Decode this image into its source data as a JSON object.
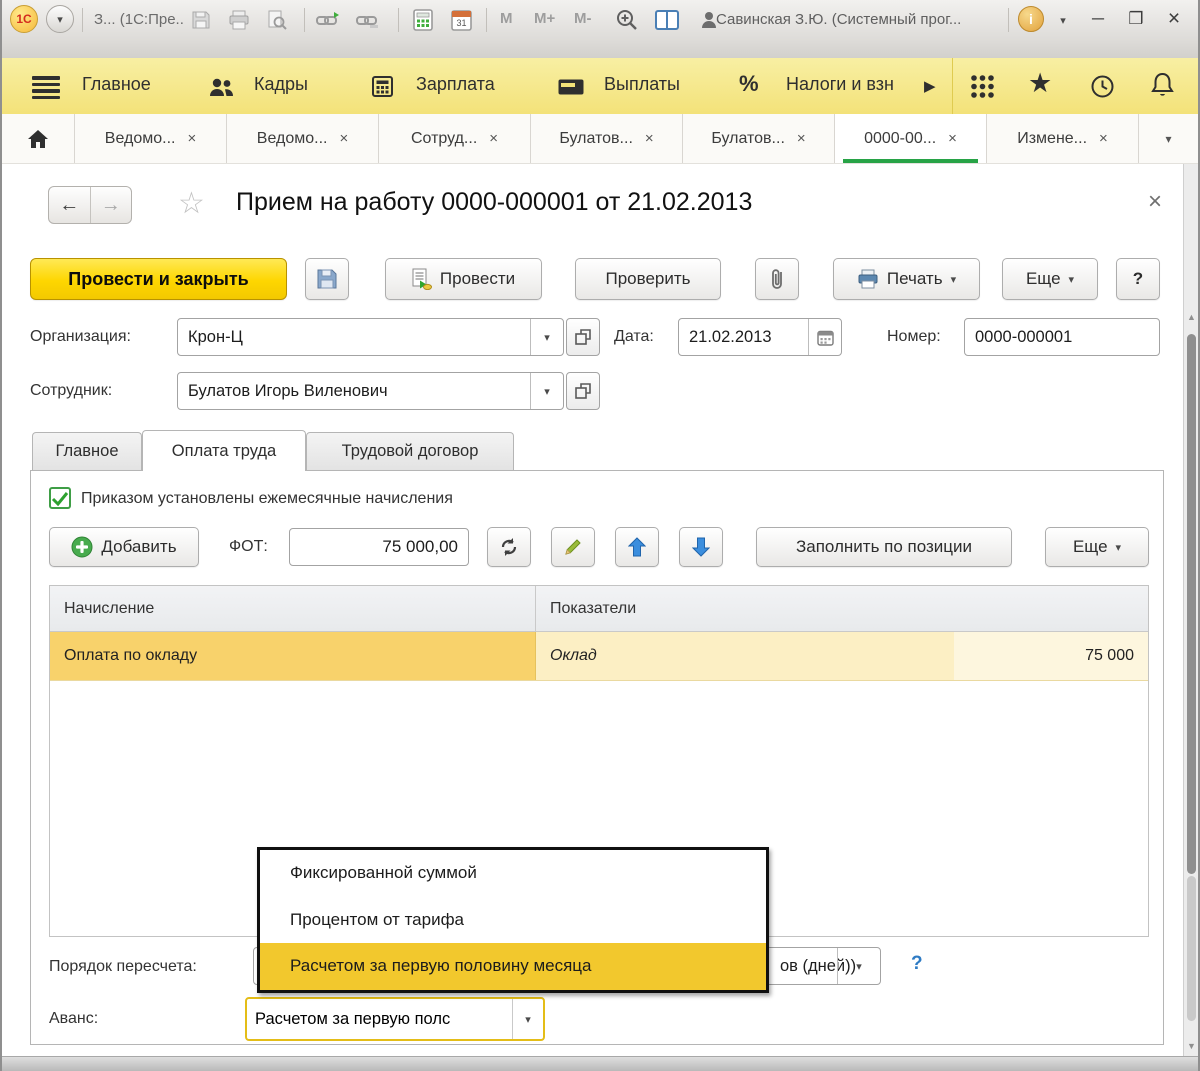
{
  "glyphs": {
    "caret_down": "▾",
    "play_right": "▶",
    "star": "★",
    "star_outline": "☆",
    "back": "←",
    "forward": "→",
    "close": "×",
    "minimize": "─",
    "maximize": "❒",
    "up_small": "▲",
    "down_small": "▼"
  },
  "titlebar": {
    "logo_text": "1С",
    "app_title": "З... (1С:Пре..",
    "memory_buttons": [
      "M",
      "M+",
      "M-"
    ],
    "calendar_day": "31",
    "user_name": "Савинская З.Ю. (Системный прог..."
  },
  "menubar": {
    "items": [
      {
        "label": "Главное"
      },
      {
        "label": "Кадры"
      },
      {
        "label": "Зарплата"
      },
      {
        "label": "Выплаты"
      },
      {
        "label": "Налоги и взн"
      }
    ],
    "percent_glyph": "%"
  },
  "tabbar": {
    "tabs": [
      {
        "label": "Ведомо..."
      },
      {
        "label": "Ведомо..."
      },
      {
        "label": "Сотруд..."
      },
      {
        "label": "Булатов..."
      },
      {
        "label": "Булатов..."
      },
      {
        "label": "0000-00...",
        "active": true
      },
      {
        "label": "Измене..."
      }
    ]
  },
  "document": {
    "title": "Прием на работу 0000-000001 от 21.02.2013",
    "toolbar": {
      "post_close": "Провести и закрыть",
      "post": "Провести",
      "check": "Проверить",
      "print": "Печать",
      "more": "Еще",
      "help": "?"
    },
    "fields": {
      "org_label": "Организация:",
      "org_value": "Крон-Ц",
      "date_label": "Дата:",
      "date_value": "21.02.2013",
      "number_label": "Номер:",
      "number_value": "0000-000001",
      "employee_label": "Сотрудник:",
      "employee_value": "Булатов Игорь Виленович"
    },
    "tabs": [
      {
        "label": "Главное"
      },
      {
        "label": "Оплата труда",
        "active": true
      },
      {
        "label": "Трудовой договор"
      }
    ],
    "payroll": {
      "checkbox_label": "Приказом установлены ежемесячные начисления",
      "add_button": "Добавить",
      "fot_label": "ФОТ:",
      "fot_value": "75 000,00",
      "fill_by_position": "Заполнить по позиции",
      "more": "Еще",
      "table": {
        "headers": [
          "Начисление",
          "Показатели"
        ],
        "rows": [
          {
            "accrual": "Оплата по окладу",
            "indicator": "Оклад",
            "value": "75 000"
          }
        ]
      }
    },
    "recalc": {
      "label": "Порядок пересчета:",
      "visible_fragment": "ов (дней))",
      "help": "?"
    },
    "advance": {
      "label": "Аванс:",
      "value": "Расчетом за первую полс"
    },
    "dropdown": {
      "items": [
        {
          "label": "Фиксированной суммой"
        },
        {
          "label": "Процентом от тарифа"
        },
        {
          "label": "Расчетом за первую половину месяца",
          "selected": true
        }
      ]
    }
  }
}
